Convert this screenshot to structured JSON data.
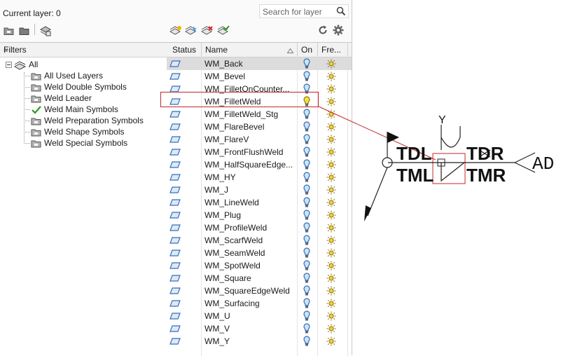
{
  "palette": {
    "accent_red": "#c0282a",
    "layer_blue": "#3a6fb8",
    "bulb_on": "#2d6fb5",
    "bulb_yellow": "#f5e04a"
  },
  "header": {
    "current_layer": "Current layer: 0",
    "search_placeholder": "Search for layer",
    "search_icon": "magnifier-icon"
  },
  "toolbar_left": [
    {
      "name": "new-property-filter-icon"
    },
    {
      "name": "new-group-filter-icon"
    },
    {
      "name": "layer-states-manager-icon"
    }
  ],
  "toolbar_right": [
    {
      "name": "new-layer-icon"
    },
    {
      "name": "new-layer-vp-frozen-icon"
    },
    {
      "name": "delete-layer-icon"
    },
    {
      "name": "set-current-icon"
    },
    {
      "name": "refresh-icon"
    },
    {
      "name": "settings-icon"
    }
  ],
  "filters": {
    "title": "Filters",
    "collapse_glyph": "«",
    "root": "All",
    "items": [
      {
        "label": "All Used Layers",
        "checked": false
      },
      {
        "label": "Weld Double Symbols",
        "checked": false
      },
      {
        "label": "Weld Leader",
        "checked": false
      },
      {
        "label": "Weld Main Symbols",
        "checked": true
      },
      {
        "label": "Weld Preparation Symbols",
        "checked": false
      },
      {
        "label": "Weld Shape Symbols",
        "checked": false
      },
      {
        "label": "Weld Special Symbols",
        "checked": false
      }
    ]
  },
  "columns": {
    "status": "Status",
    "name": "Name",
    "on": "On",
    "freeze": "Fre..."
  },
  "layers": [
    {
      "name": "WM_Back",
      "selected": true,
      "bulb": "on"
    },
    {
      "name": "WM_Bevel",
      "bulb": "on"
    },
    {
      "name": "WM_FilletOnCounter...",
      "bulb": "on"
    },
    {
      "name": "WM_FilletWeld",
      "bulb": "yellow",
      "highlighted": true
    },
    {
      "name": "WM_FilletWeld_Stg",
      "bulb": "on"
    },
    {
      "name": "WM_FlareBevel",
      "bulb": "on"
    },
    {
      "name": "WM_FlareV",
      "bulb": "on"
    },
    {
      "name": "WM_FrontFlushWeld",
      "bulb": "on"
    },
    {
      "name": "WM_HalfSquareEdge...",
      "bulb": "on"
    },
    {
      "name": "WM_HY",
      "bulb": "on"
    },
    {
      "name": "WM_J",
      "bulb": "on"
    },
    {
      "name": "WM_LineWeld",
      "bulb": "on"
    },
    {
      "name": "WM_Plug",
      "bulb": "on"
    },
    {
      "name": "WM_ProfileWeld",
      "bulb": "on"
    },
    {
      "name": "WM_ScarfWeld",
      "bulb": "on"
    },
    {
      "name": "WM_SeamWeld",
      "bulb": "on"
    },
    {
      "name": "WM_SpotWeld",
      "bulb": "on"
    },
    {
      "name": "WM_Square",
      "bulb": "on"
    },
    {
      "name": "WM_SquareEdgeWeld",
      "bulb": "on"
    },
    {
      "name": "WM_Surfacing",
      "bulb": "on"
    },
    {
      "name": "WM_U",
      "bulb": "on"
    },
    {
      "name": "WM_V",
      "bulb": "on"
    },
    {
      "name": "WM_Y",
      "bulb": "on"
    }
  ],
  "drawing": {
    "labels": {
      "y": "Y",
      "tdl": "TDL",
      "tml": "TML",
      "tdr": "TDR",
      "tmr": "TMR",
      "ad": "AD"
    }
  }
}
